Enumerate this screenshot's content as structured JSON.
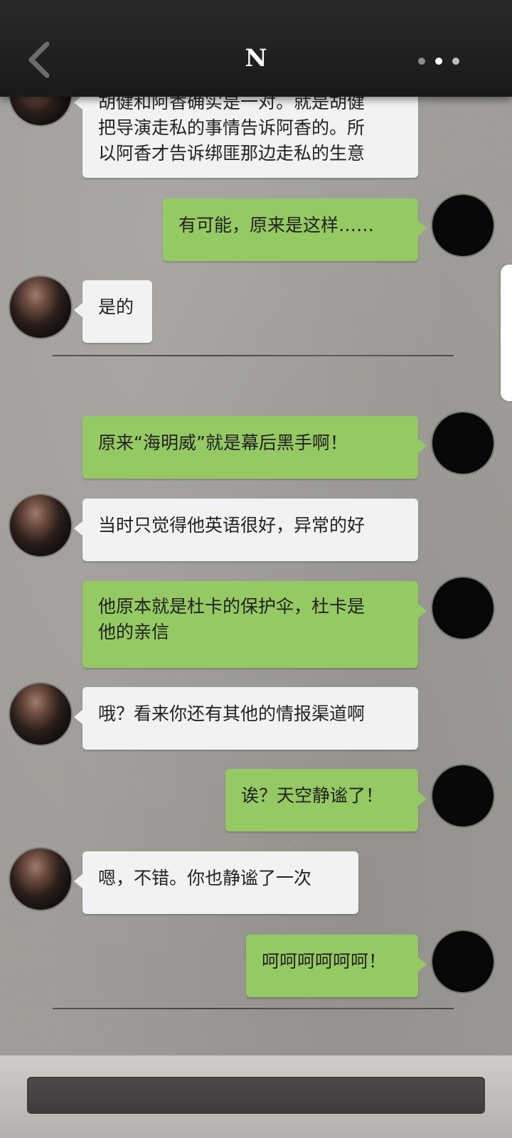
{
  "header": {
    "title": "N",
    "back_icon": "chevron-left-icon",
    "more_icon": "more-dots-icon",
    "dot_colors": [
      "#8c8c8c",
      "#ffffff",
      "#bdbdbd"
    ]
  },
  "messages": [
    {
      "from": "npc",
      "lines": [
        "胡健和阿香确实是一对。就是胡健",
        "把导演走私的事情告诉阿香的。所",
        "以阿香才告诉绑匪那边走私的生意"
      ]
    },
    {
      "from": "me",
      "lines": [
        "有可能，原来是这样……"
      ]
    },
    {
      "from": "npc",
      "lines": [
        "是的"
      ]
    },
    {
      "from": "me",
      "lines": [
        "原来“海明威”就是幕后黑手啊！"
      ]
    },
    {
      "from": "npc",
      "lines": [
        "当时只觉得他英语很好，异常的好"
      ]
    },
    {
      "from": "me",
      "lines": [
        "他原本就是杜卡的保护伞，杜卡是",
        "他的亲信"
      ]
    },
    {
      "from": "npc",
      "lines": [
        "哦？看来你还有其他的情报渠道啊"
      ]
    },
    {
      "from": "me",
      "lines": [
        "诶？天空静谧了！"
      ]
    },
    {
      "from": "npc",
      "lines": [
        "嗯，不错。你也静谧了一次"
      ]
    },
    {
      "from": "me",
      "lines": [
        "呵呵呵呵呵呵！"
      ]
    }
  ],
  "input": {
    "placeholder": ""
  },
  "colors": {
    "my_bubble": "#95c964",
    "their_bubble": "#f2f2f2",
    "header": "#1f1e1e"
  }
}
